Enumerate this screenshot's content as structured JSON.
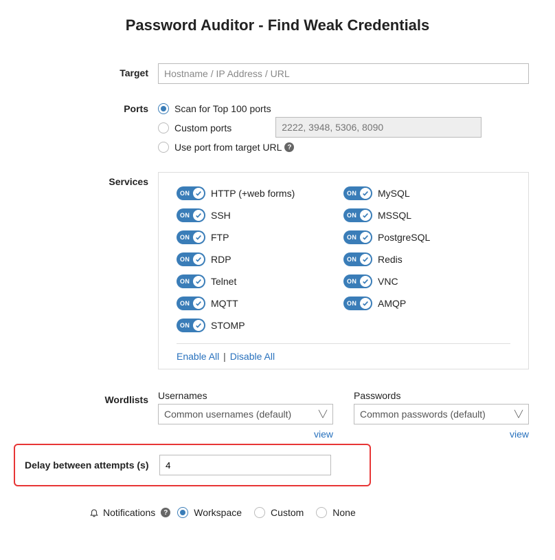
{
  "title": "Password Auditor - Find Weak Credentials",
  "target": {
    "label": "Target",
    "placeholder": "Hostname / IP Address / URL"
  },
  "ports": {
    "label": "Ports",
    "opt_top100": "Scan for Top 100 ports",
    "opt_custom": "Custom ports",
    "opt_url": "Use port from target URL",
    "custom_placeholder": "2222, 3948, 5306, 8090"
  },
  "services": {
    "label": "Services",
    "left": [
      "HTTP (+web forms)",
      "SSH",
      "FTP",
      "RDP",
      "Telnet",
      "MQTT",
      "STOMP"
    ],
    "right": [
      "MySQL",
      "MSSQL",
      "PostgreSQL",
      "Redis",
      "VNC",
      "AMQP"
    ],
    "toggle_on": "ON",
    "enable_all": "Enable All",
    "disable_all": "Disable All"
  },
  "wordlists": {
    "label": "Wordlists",
    "usernames_label": "Usernames",
    "usernames_value": "Common usernames (default)",
    "passwords_label": "Passwords",
    "passwords_value": "Common passwords (default)",
    "view": "view"
  },
  "delay": {
    "label": "Delay between attempts (s)",
    "value": "4"
  },
  "notifications": {
    "label": "Notifications",
    "opt_workspace": "Workspace",
    "opt_custom": "Custom",
    "opt_none": "None"
  }
}
